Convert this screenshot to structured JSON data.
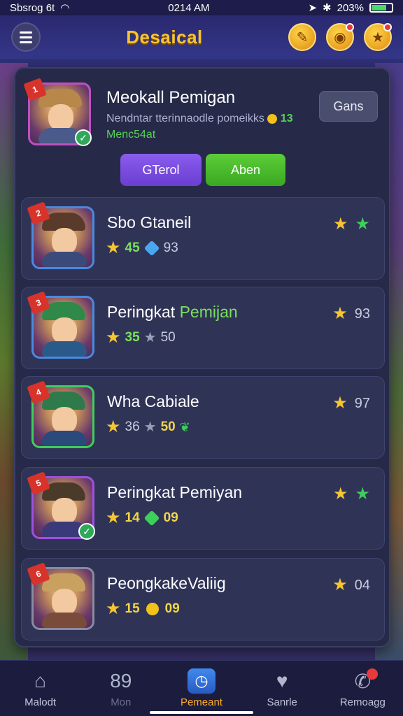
{
  "status_bar": {
    "left_text": "Sbsrog 6t",
    "time": "0214 AM",
    "battery": "203%"
  },
  "header": {
    "title": "Desaical"
  },
  "top_player": {
    "rank": "1",
    "name": "Meokall Pemigan",
    "description": "Nendntar tterinnaodle pomeikks",
    "points": "13",
    "subtitle": "Menc54at",
    "side_button": "Gans",
    "button_primary": "GTerol",
    "button_secondary": "Aben"
  },
  "rows": [
    {
      "rank": "2",
      "name": "Sbo Gtaneil",
      "stat1": "45",
      "stat2": "93",
      "right_value": ""
    },
    {
      "rank": "3",
      "name_a": "Peringkat ",
      "name_b": "Pemijan",
      "stat1": "35",
      "stat2": "50",
      "right_value": "93"
    },
    {
      "rank": "4",
      "name": "Wha Cabiale",
      "stat1": "36",
      "stat2": "50",
      "right_value": "97"
    },
    {
      "rank": "5",
      "name": "Peringkat Pemiyan",
      "stat1": "14",
      "stat2": "09",
      "right_value": ""
    },
    {
      "rank": "6",
      "name": "PeongkakeValiig",
      "stat1": "15",
      "stat2": "09",
      "right_value": "04"
    }
  ],
  "bottom_nav": [
    {
      "label": "Malodt",
      "icon": "home-icon"
    },
    {
      "label": "Mon",
      "icon": "mon-icon",
      "glyph": "89"
    },
    {
      "label": "Pemeant",
      "icon": "clock-icon"
    },
    {
      "label": "Sanrle",
      "icon": "heart-icon"
    },
    {
      "label": "Remoagg",
      "icon": "chat-icon"
    }
  ],
  "colors": {
    "accent_gold": "#f7c531",
    "active_nav": "#ffae2a",
    "green": "#56d256",
    "panel": "#262a48"
  }
}
